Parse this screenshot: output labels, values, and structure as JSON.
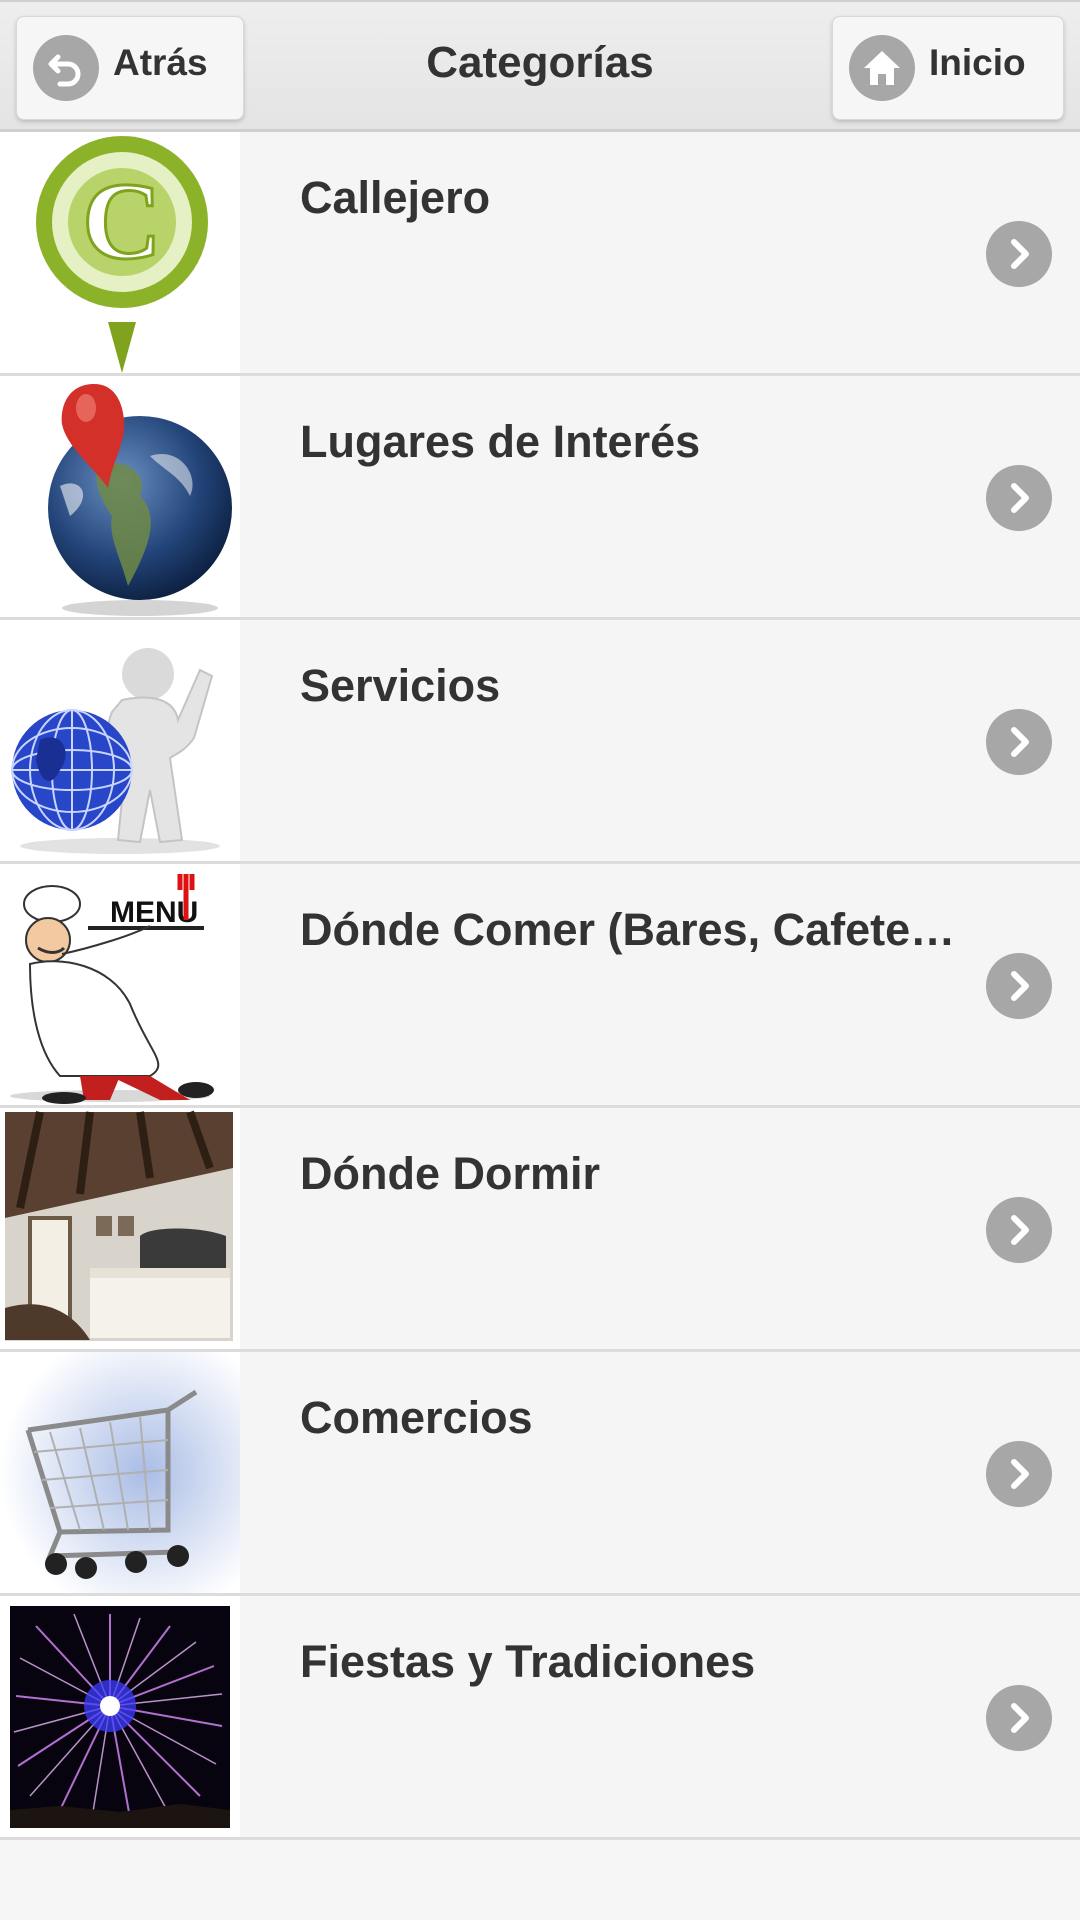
{
  "header": {
    "title": "Categorías",
    "back_label": "Atrás",
    "home_label": "Inicio"
  },
  "categories": [
    {
      "label": "Callejero",
      "icon": "callejero-pin-icon"
    },
    {
      "label": "Lugares de Interés",
      "icon": "globe-pin-icon"
    },
    {
      "label": "Servicios",
      "icon": "globe-figure-icon"
    },
    {
      "label": "Dónde Comer (Bares, Cafeterías, Restaurantes)",
      "icon": "chef-menu-icon"
    },
    {
      "label": "Dónde Dormir",
      "icon": "bedroom-photo"
    },
    {
      "label": "Comercios",
      "icon": "shopping-cart-icon"
    },
    {
      "label": "Fiestas y Tradiciones",
      "icon": "fireworks-photo"
    }
  ],
  "thumb_text": {
    "callejero_letter": "C",
    "menu_text": "MENU"
  }
}
